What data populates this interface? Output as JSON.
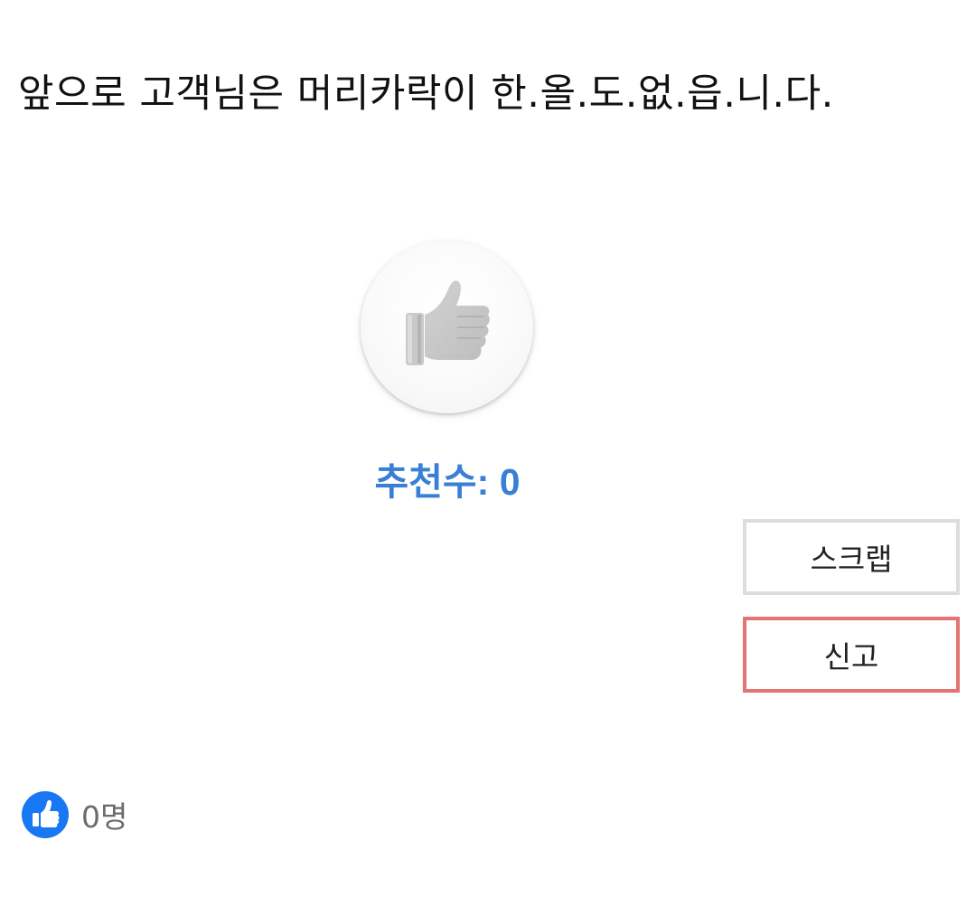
{
  "post": {
    "body_text": "앞으로 고객님은 머리카락이 한.올.도.없.읍.니.다."
  },
  "recommend": {
    "icon": "thumbs-up-icon",
    "count_label": "추천수: 0"
  },
  "actions": {
    "scrap_label": "스크랩",
    "report_label": "신고"
  },
  "likes": {
    "icon": "thumbs-up-badge-icon",
    "count_text": "0명"
  },
  "colors": {
    "accent_blue": "#3a7fd5",
    "like_badge_blue": "#1877f2",
    "report_border": "#e57373",
    "scrap_border": "#dddddd"
  }
}
